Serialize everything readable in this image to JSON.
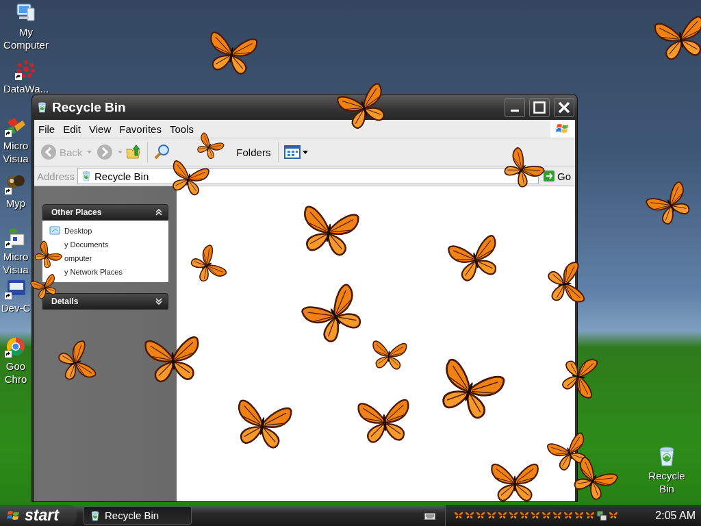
{
  "desktop_icons": [
    {
      "label_lines": [
        "My",
        "Computer"
      ],
      "shortcut": false
    },
    {
      "label_lines": [
        "DataWa..."
      ],
      "shortcut": true
    },
    {
      "label_lines": [
        "Micro",
        "Visua"
      ],
      "shortcut": true
    },
    {
      "label_lines": [
        "Myp"
      ],
      "shortcut": true
    },
    {
      "label_lines": [
        "Micro",
        "Visua"
      ],
      "shortcut": true
    },
    {
      "label_lines": [
        "Dev-C"
      ],
      "shortcut": true
    },
    {
      "label_lines": [
        "Goo",
        "Chro"
      ],
      "shortcut": true
    }
  ],
  "recycle_bin_icon": {
    "label_lines": [
      "Recycle",
      "Bin"
    ]
  },
  "window": {
    "title": "Recycle Bin",
    "menu": [
      "File",
      "Edit",
      "View",
      "Favorites",
      "Tools"
    ],
    "toolbar": {
      "back": {
        "label": "Back",
        "disabled": true
      },
      "forward": {
        "disabled": true
      },
      "folders": {
        "label": "Folders"
      }
    },
    "address": {
      "label": "Address",
      "value": "Recycle Bin",
      "go": "Go"
    },
    "task_panes": [
      {
        "title": "Other Places",
        "expanded": true,
        "items": [
          {
            "label": "Desktop",
            "icon": true
          },
          {
            "label": "y Documents",
            "icon": false
          },
          {
            "label": "omputer",
            "icon": false
          },
          {
            "label": "y Network Places",
            "icon": false
          }
        ]
      },
      {
        "title": "Details",
        "expanded": false
      }
    ]
  },
  "taskbar": {
    "start": "start",
    "tasks": [
      {
        "label": "Recycle Bin",
        "selected": true
      }
    ],
    "clock": "2:05 AM"
  }
}
